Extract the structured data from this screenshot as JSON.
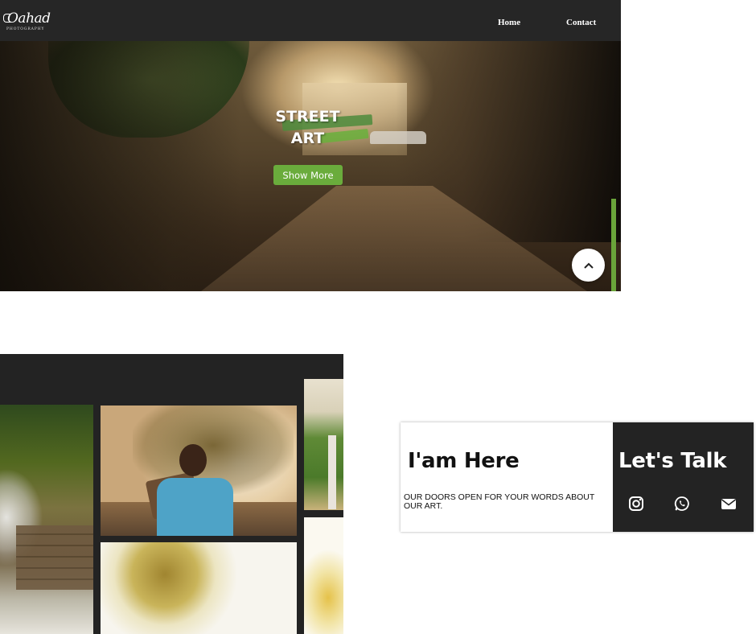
{
  "navbar": {
    "logo_word": "Oahad",
    "logo_sub": "PHOTOGRAPHY",
    "links": [
      {
        "label": "Home"
      },
      {
        "label": "Contact"
      }
    ]
  },
  "hero": {
    "title_line1": "STREET",
    "title_line2": "ART",
    "button_label": "Show More",
    "scroll_top_icon": "chevron-up-icon"
  },
  "gallery": {
    "photos": [
      {
        "subject": "waterfall"
      },
      {
        "subject": "boy-with-tool"
      },
      {
        "subject": "tree"
      },
      {
        "subject": "field"
      },
      {
        "subject": "yellow-flowers"
      }
    ]
  },
  "contact": {
    "left_title": "I'am Here",
    "left_text": "OUR DOORS OPEN FOR YOUR WORDS ABOUT OUR ART.",
    "right_title": "Let's Talk",
    "social_icons": [
      "instagram-icon",
      "whatsapp-icon",
      "mail-icon"
    ]
  },
  "colors": {
    "navbar_bg": "#262626",
    "accent_green": "#6aac3c",
    "dark_panel": "#232323"
  }
}
